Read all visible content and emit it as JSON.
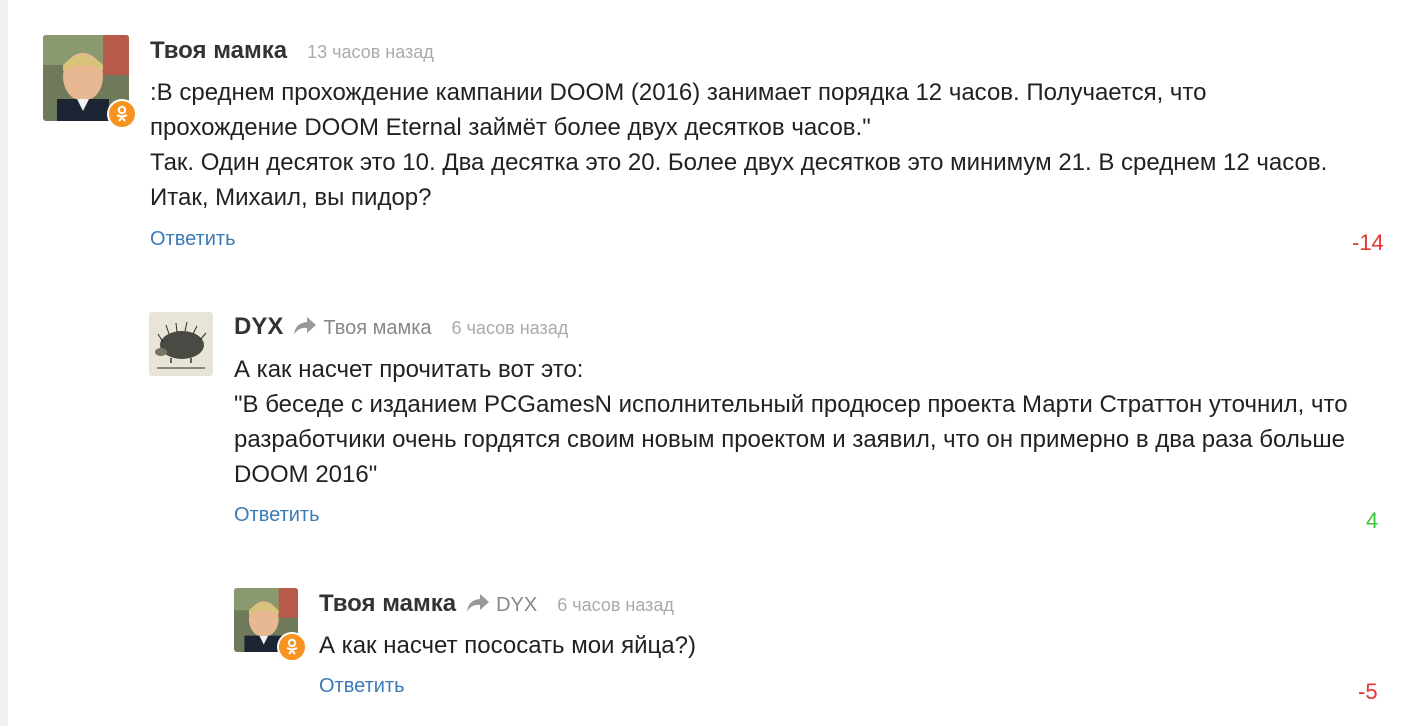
{
  "colors": {
    "link": "#3a7ab7",
    "negative": "#e3342f",
    "positive": "#3cc33c",
    "badge": "#f7931e"
  },
  "comments": [
    {
      "author": "Твоя мамка",
      "time": "13 часов назад",
      "avatar_icon": "user-photo-boy",
      "badge_icon": "odnoklassniki-icon",
      "lines": [
        ":В среднем прохождение кампании DOOM (2016) занимает порядка 12 часов. Получается, что",
        "прохождение DOOM Eternal займёт более двух десятков часов.\"",
        "Так. Один десяток это 10. Два десятка это 20. Более двух десятков это минимум 21. В среднем 12 часов.",
        "Итак, Михаил, вы пидор?"
      ],
      "reply_label": "Ответить",
      "score": "-14"
    },
    {
      "author": "DYX",
      "reply_to": "Твоя мамка",
      "time": "6 часов назад",
      "avatar_icon": "hedgehog-drawing",
      "lines": [
        "А как насчет прочитать вот это:",
        "\"В беседе с изданием PCGamesN исполнительный продюсер проекта Марти Страттон уточнил, что",
        "разработчики очень гордятся своим новым проектом и заявил, что он примерно в два раза больше",
        "DOOM 2016\""
      ],
      "reply_label": "Ответить",
      "score": "4"
    },
    {
      "author": "Твоя мамка",
      "reply_to": "DYX",
      "time": "6 часов назад",
      "avatar_icon": "user-photo-boy",
      "badge_icon": "odnoklassniki-icon",
      "lines": [
        "А как насчет пососать мои яйца?)"
      ],
      "reply_label": "Ответить",
      "score": "-5"
    }
  ]
}
